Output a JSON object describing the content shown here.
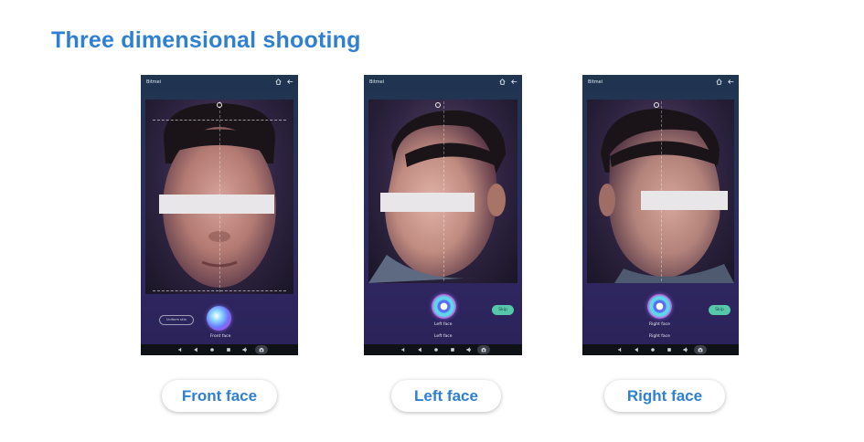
{
  "page": {
    "title": "Three dimensional shooting"
  },
  "brand": "Bitmei",
  "devices": [
    {
      "id": "front",
      "secondary_button": "Uniform skin",
      "caption": "Front face",
      "caption2": "",
      "skip": ""
    },
    {
      "id": "left",
      "secondary_button": "",
      "caption": "Left face",
      "caption2": "Left face",
      "skip": "Skip"
    },
    {
      "id": "right",
      "secondary_button": "",
      "caption": "Right face",
      "caption2": "Right face",
      "skip": "Skip"
    }
  ],
  "labels": [
    "Front face",
    "Left face",
    "Right face"
  ],
  "colors": {
    "accent": "#2f7fd3",
    "skip": "#56c7a8",
    "navbar": "#0e1116"
  },
  "icons": {
    "top": [
      "home-icon",
      "back-arrow-icon"
    ],
    "nav": [
      "volume-down-icon",
      "back-icon",
      "home-circle-icon",
      "recents-icon",
      "volume-up-icon",
      "camera-icon"
    ]
  }
}
